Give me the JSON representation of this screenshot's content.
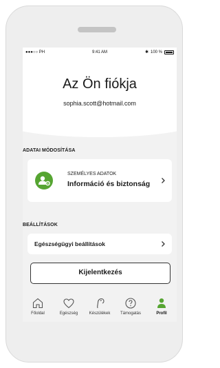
{
  "status_bar": {
    "carrier": "●●●○○ PH",
    "time": "9:41 AM",
    "battery": "100 %"
  },
  "header": {
    "title": "Az Ön fiókja",
    "email": "sophia.scott@hotmail.com"
  },
  "sections": {
    "data_edit": {
      "label": "ADATAI MÓDOSÍTÁSA",
      "item": {
        "overline": "SZEMÉLYES ADATOK",
        "title": "Információ és biztonság"
      }
    },
    "settings": {
      "label": "BEÁLLÍTÁSOK",
      "item": {
        "title": "Egészségügyi beállítások"
      }
    }
  },
  "logout_label": "Kijelentkezés",
  "tabbar": {
    "tabs": [
      {
        "label": "Főoldal",
        "icon": "home-icon"
      },
      {
        "label": "Egészség",
        "icon": "heart-icon"
      },
      {
        "label": "Készülékek",
        "icon": "hearing-aid-icon"
      },
      {
        "label": "Támogatás",
        "icon": "help-icon"
      },
      {
        "label": "Profil",
        "icon": "profile-icon"
      }
    ],
    "active_tab": "Profil"
  },
  "colors": {
    "accent": "#56a532",
    "background": "#f2f2f2",
    "card": "#ffffff"
  }
}
